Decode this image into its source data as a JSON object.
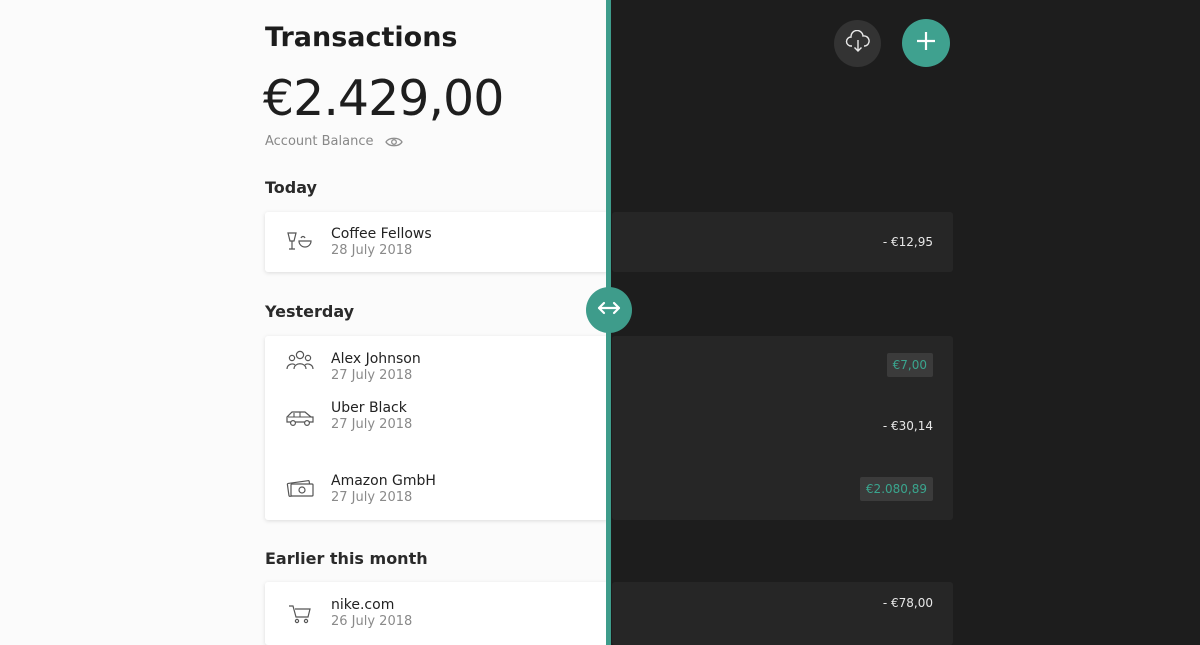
{
  "header": {
    "title": "Transactions",
    "balance": "€2.429,00",
    "balance_label": "Account Balance"
  },
  "toolbar": {
    "download_icon": "cloud-download-icon",
    "add_icon": "plus-icon"
  },
  "compare_slider": {
    "icon": "left-right-arrow-icon"
  },
  "sections": [
    {
      "heading": "Today",
      "items": [
        {
          "name": "Coffee Fellows",
          "date": "28 July 2018",
          "amount": "- €12,95",
          "icon": "coffee-icon",
          "positive": false
        }
      ]
    },
    {
      "heading": "Yesterday",
      "items": [
        {
          "name": "Alex Johnson",
          "date": "27 July 2018",
          "amount": "€7,00",
          "icon": "people-icon",
          "positive": true
        },
        {
          "name": "Uber Black",
          "date": "27 July 2018",
          "amount": "- €30,14",
          "icon": "car-icon",
          "positive": false
        },
        {
          "name": "Amazon GmbH",
          "date": "27 July 2018",
          "amount": "€2.080,89",
          "icon": "money-icon",
          "positive": true
        }
      ]
    },
    {
      "heading": "Earlier this month",
      "items": [
        {
          "name": "nike.com",
          "date": "26 July 2018",
          "amount": "- €78,00",
          "icon": "cart-icon",
          "positive": false
        }
      ]
    }
  ],
  "colors": {
    "accent": "#3e9c8b",
    "light_bg": "#fbfbfb",
    "dark_bg": "#1d1d1d",
    "dark_card": "#262626",
    "positive_text": "#3aa58e"
  }
}
